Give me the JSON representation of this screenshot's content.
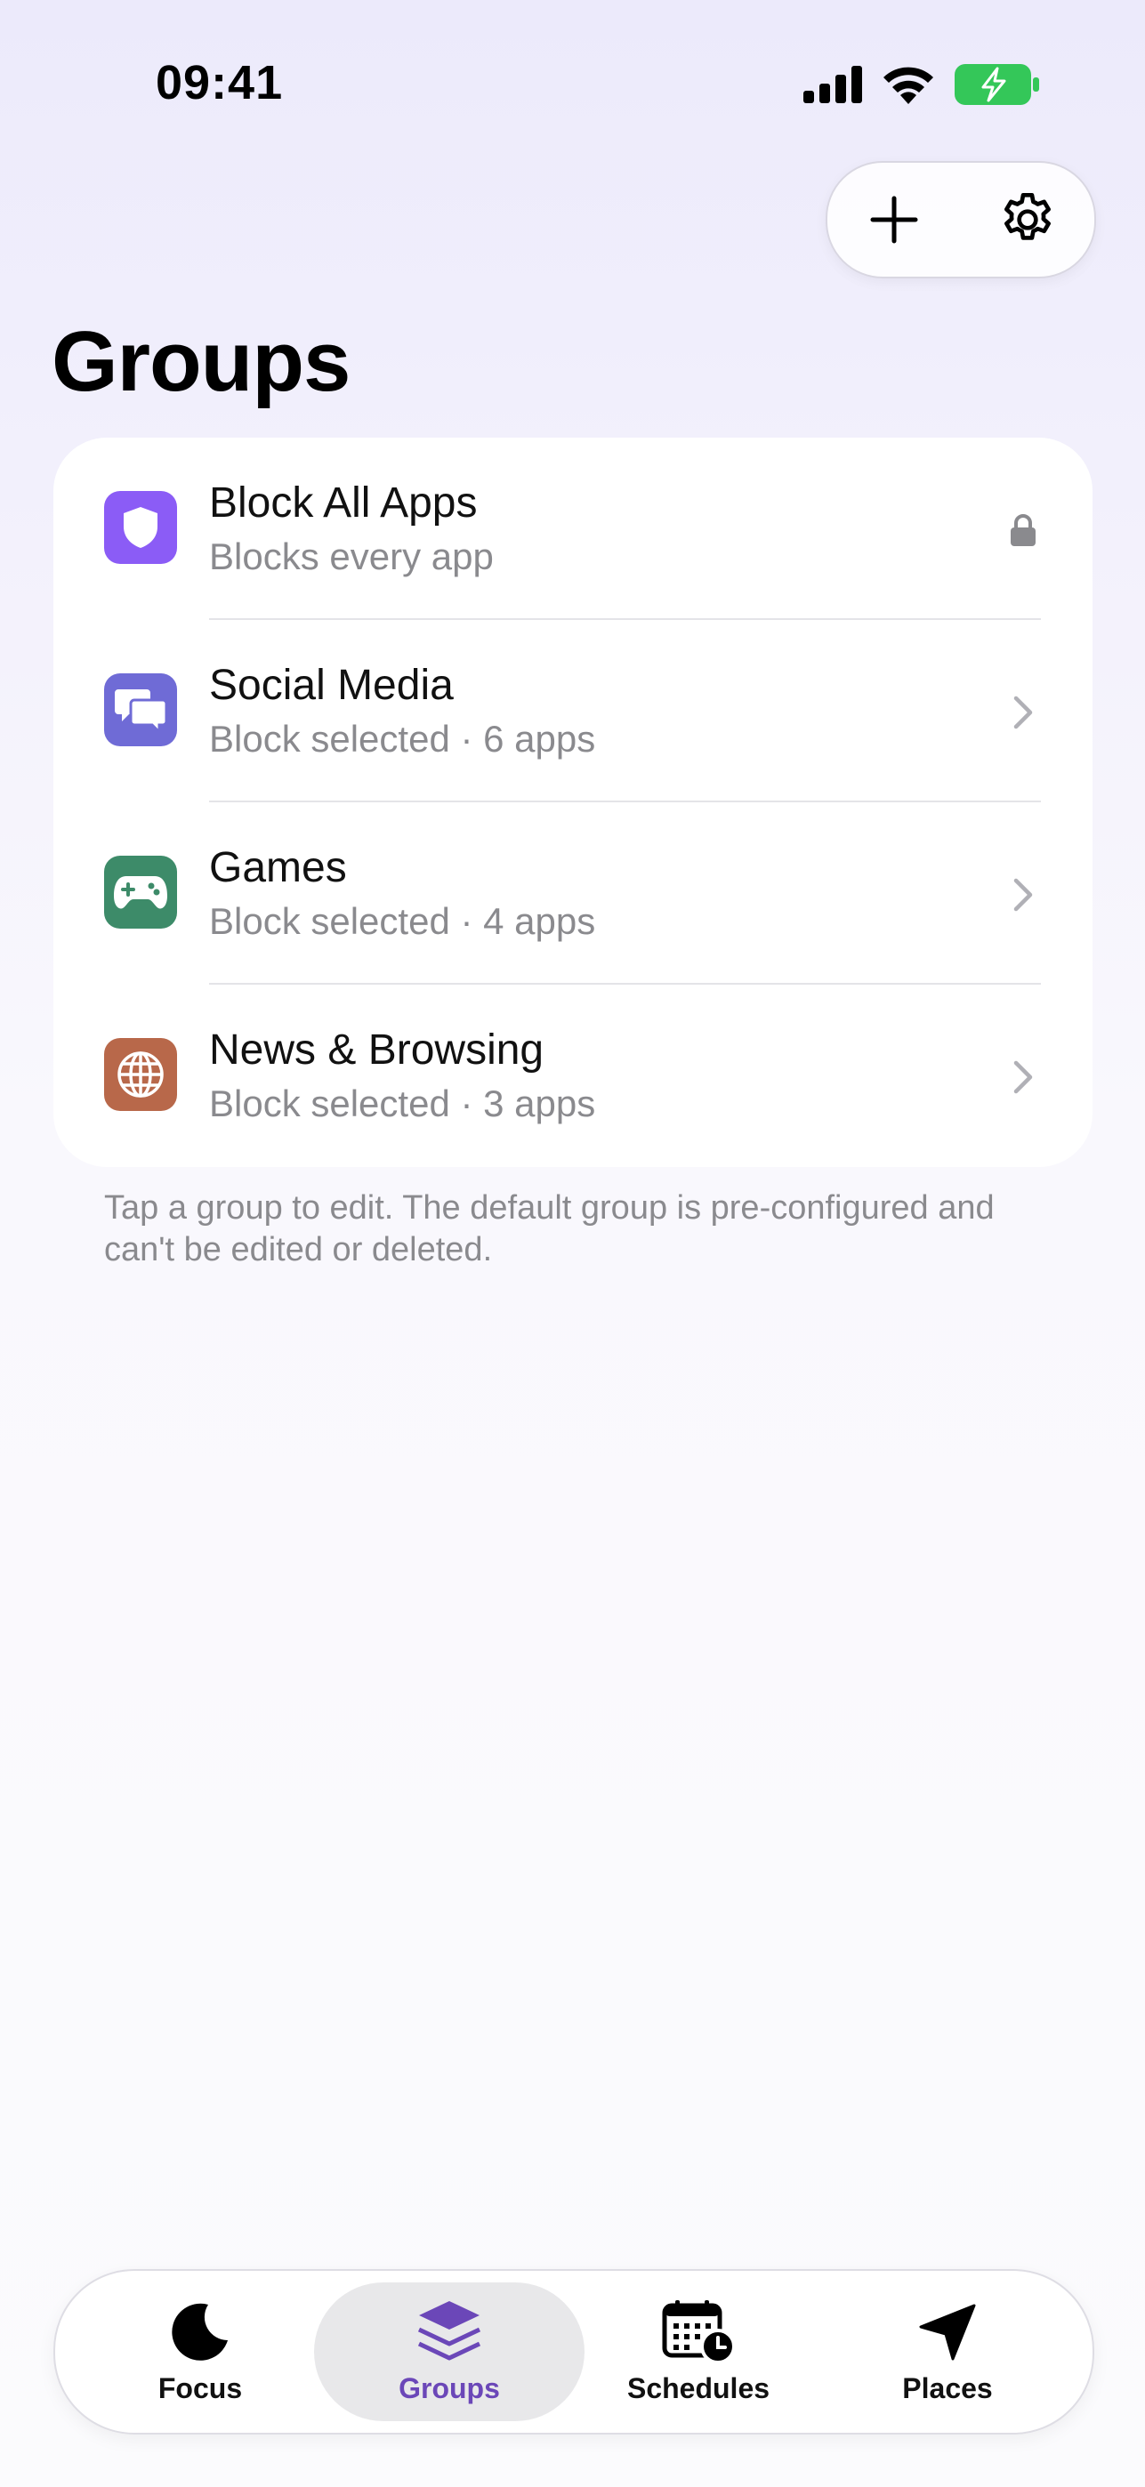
{
  "status_bar": {
    "time": "09:41"
  },
  "page": {
    "title": "Groups"
  },
  "groups": [
    {
      "title": "Block All Apps",
      "subtitle": "Blocks every app",
      "icon": "shield-icon",
      "color": "#8B5CF6",
      "trailing": "lock-icon"
    },
    {
      "title": "Social Media",
      "subtitle": "Block selected · 6 apps",
      "icon": "chat-bubbles-icon",
      "color": "#6F6BD6",
      "trailing": "chevron-right-icon"
    },
    {
      "title": "Games",
      "subtitle": "Block selected · 4 apps",
      "icon": "gamepad-icon",
      "color": "#3D8B69",
      "trailing": "chevron-right-icon"
    },
    {
      "title": "News & Browsing",
      "subtitle": "Block selected · 3 apps",
      "icon": "globe-icon",
      "color": "#B8684A",
      "trailing": "chevron-right-icon"
    }
  ],
  "footnote": "Tap a group to edit. The default group is pre-configured and can't be edited or deleted.",
  "tabs": [
    {
      "label": "Focus",
      "icon": "moon-icon"
    },
    {
      "label": "Groups",
      "icon": "layers-icon",
      "active": true
    },
    {
      "label": "Schedules",
      "icon": "calendar-clock-icon"
    },
    {
      "label": "Places",
      "icon": "location-arrow-icon"
    }
  ],
  "colors": {
    "accent": "#6B47B8",
    "battery": "#34C759"
  }
}
